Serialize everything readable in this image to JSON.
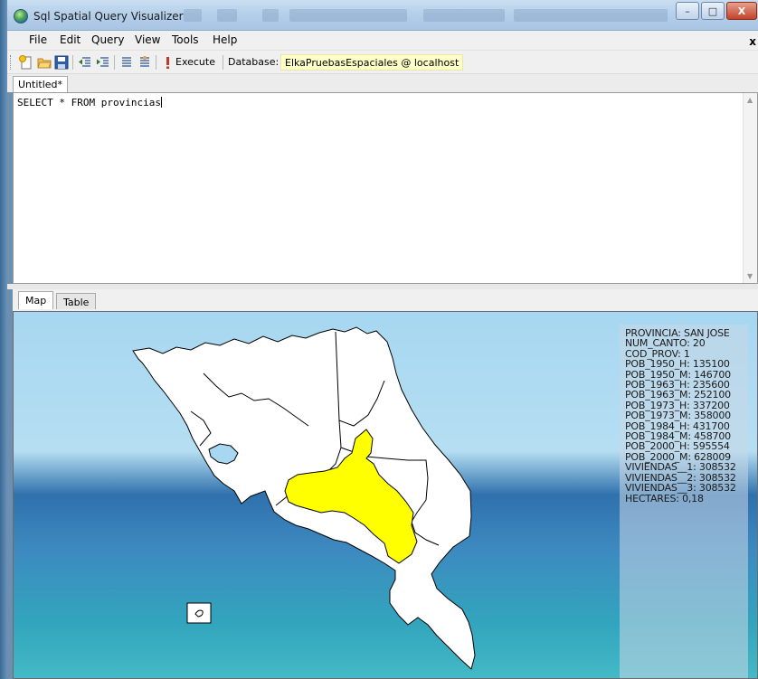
{
  "window": {
    "title": "Sql Spatial Query Visualizer",
    "controls": {
      "minimize": "–",
      "maximize": "□",
      "close": "X"
    }
  },
  "menu": [
    "File",
    "Edit",
    "Query",
    "View",
    "Tools",
    "Help"
  ],
  "menu_close": "x",
  "toolbar": {
    "execute_label": "Execute",
    "database_label": "Database:",
    "database_value": "ElkaPruebasEspaciales @ localhost"
  },
  "document_tab": "Untitled*",
  "editor": {
    "query": "SELECT * FROM provincias"
  },
  "result_tabs": [
    "Map",
    "Table"
  ],
  "colors": {
    "selected_province": "#ffff00",
    "province_fill": "#ffffff",
    "province_stroke": "#000000"
  },
  "info_panel": [
    "PROVINCIA: SAN JOSE",
    "NUM_CANTO: 20",
    "COD_PROV: 1",
    "POB_1950_H: 135100",
    "POB_1950_M: 146700",
    "POB_1963_H: 235600",
    "POB_1963_M: 252100",
    "POB_1973_H: 337200",
    "POB_1973_M: 358000",
    "POB_1984_H: 431700",
    "POB_1984_M: 458700",
    "POB_2000_H: 595554",
    "POB_2000_M: 628009",
    "VIVIENDAS__1: 308532",
    "VIVIENDAS__2: 308532",
    "VIVIENDAS__3: 308532",
    "HECTARES: 0,18"
  ]
}
